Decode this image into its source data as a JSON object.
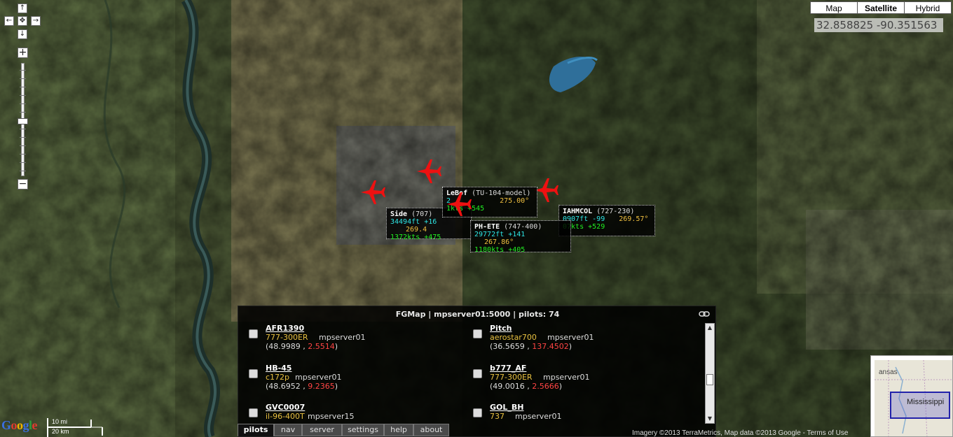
{
  "map_types": {
    "map": "Map",
    "satellite": "Satellite",
    "hybrid": "Hybrid",
    "active": "satellite"
  },
  "coords": "32.858825 -90.351563",
  "pan_controls": {
    "up": "↑",
    "left": "←",
    "center": "✥",
    "right": "→",
    "down": "↓"
  },
  "zoom_controls": {
    "in": "+",
    "out": "−"
  },
  "aircraft": [
    {
      "callsign": "Side",
      "model": "(707)",
      "altitude": "34494ft",
      "climb": "+16",
      "speed": "1372kts",
      "speed_delta": "+475",
      "heading": "269.4"
    },
    {
      "callsign": "LeBof",
      "model": "(TU-104-model)",
      "altitude": "2",
      "climb": "",
      "speed": "1",
      "speed_delta": "kts +545",
      "heading": "275.00°"
    },
    {
      "callsign": "PH-ETE",
      "model": "(747-400)",
      "altitude": "29772ft",
      "climb": "+141",
      "speed": "1180kts",
      "speed_delta": "+405",
      "heading": "267.86°"
    },
    {
      "callsign": "IAHMCOL",
      "model": "(727-230)",
      "altitude": "0907ft",
      "climb": "-99",
      "speed": "07kts",
      "speed_delta": "+529",
      "heading": "269.57°"
    }
  ],
  "panel": {
    "title": "FGMap | mpserver01:5000 | pilots: 74",
    "pilots": [
      {
        "callsign": "AFR1390",
        "aircraft": "777-300ER",
        "server": "mpserver01",
        "lat": "48.9989",
        "lon": "2.5514"
      },
      {
        "callsign": "Pitch",
        "aircraft": "aerostar700",
        "server": "mpserver01",
        "lat": "36.5659",
        "lon": "137.4502"
      },
      {
        "callsign": "HB-45",
        "aircraft": "c172p",
        "server": "mpserver01",
        "lat": "48.6952",
        "lon": "9.2365"
      },
      {
        "callsign": "b777_AF",
        "aircraft": "777-300ER",
        "server": "mpserver01",
        "lat": "49.0016",
        "lon": "2.5666"
      },
      {
        "callsign": "GVC0007",
        "aircraft": "il-96-400T",
        "server": "mpserver15",
        "lat": "",
        "lon": ""
      },
      {
        "callsign": "GOL_BH",
        "aircraft": "737",
        "server": "mpserver01",
        "lat": "",
        "lon": ""
      }
    ],
    "tabs": [
      "pilots",
      "nav",
      "server",
      "settings",
      "help",
      "about"
    ],
    "active_tab": "pilots"
  },
  "overview": {
    "state_label": "Mississippi",
    "corner_label": "ansas"
  },
  "scale": {
    "upper": "10 mi",
    "lower": "20 km"
  },
  "logo": "Google",
  "copyright": "Imagery ©2013 TerraMetrics, Map data ©2013 Google - Terms of Use",
  "colors": {
    "plane": "#ee1111",
    "lon": "#ff4444",
    "aircraft_type": "#e8c040",
    "altitude": "#2ee6e6",
    "speed": "#22ee22"
  }
}
